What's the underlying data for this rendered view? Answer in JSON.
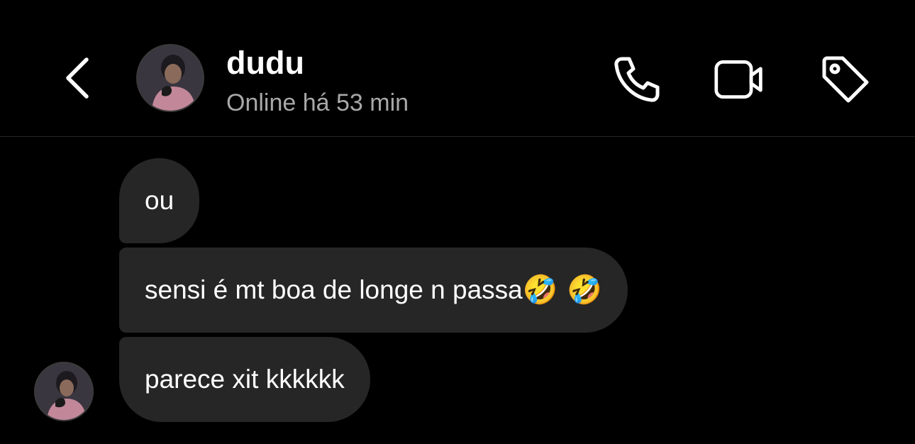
{
  "header": {
    "contact_name": "dudu",
    "status": "Online há 53 min",
    "icons": {
      "back": "chevron-left-icon",
      "call": "phone-icon",
      "video": "video-camera-icon",
      "tag": "tag-icon"
    }
  },
  "messages": [
    {
      "sender": "dudu",
      "text": "ou"
    },
    {
      "sender": "dudu",
      "text": "sensi é mt boa de longe n passa",
      "emoji": "🤣 🤣"
    },
    {
      "sender": "dudu",
      "text": "parece xit kkkkkk"
    }
  ],
  "colors": {
    "background": "#000000",
    "bubble": "#262626",
    "text": "#ffffff",
    "secondary_text": "#a8a8a8",
    "divider": "#262626"
  }
}
